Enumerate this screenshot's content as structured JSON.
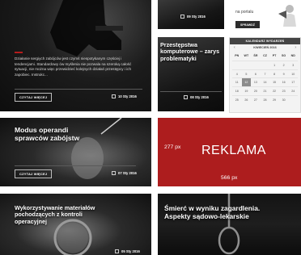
{
  "read_more_label": "CZYTAJ WIĘCEJ",
  "card_top_left": {
    "excerpt": "Działanie sergiych zabójców jest czymś niespotykanym częściej i tendencjami. Standardowy ów myślenia nie pozwala na szeroką całość sytuacji, nie można więc przewidzieć kolejnych działań przestępcy i ich zapobiec. Instrukc...",
    "date": "10 Sty 2016"
  },
  "card_top_middle": {
    "date": "09 Sty 2016"
  },
  "card_przestepstwa": {
    "title": "Przestępstwa komputerowe – zarys problematyki",
    "date": "08 Sty 2016"
  },
  "card_modus": {
    "title": "Modus operandi sprawców zabójstw",
    "date": "07 Sty 2016"
  },
  "card_wykorzystywanie": {
    "title": "Wykorzystywanie materiałów pochodzących z kontroli operacyjnej",
    "date": "05 Sty 2016"
  },
  "card_smierc": {
    "title": "Śmierć w wyniku zagardlenia. Aspekty sądowo-lekarskie"
  },
  "promo": {
    "text": "na portalu",
    "button_label": "SPRAWDŹ"
  },
  "ad": {
    "label": "REKLAMA",
    "size_left": "277 px",
    "size_bottom": "566 px"
  },
  "calendar": {
    "heading": "KALENDARZ WYDARZEŃ",
    "month": "KWIECIEŃ 2016",
    "prev": "‹",
    "next": "›",
    "weekdays": [
      "PN",
      "WT",
      "ŚR",
      "CZ",
      "PT",
      "SO",
      "ND"
    ],
    "days": [
      "",
      "",
      "",
      "",
      "1",
      "2",
      "3",
      "4",
      "5",
      "6",
      "7",
      "8",
      "9",
      "10",
      "11",
      "12",
      "13",
      "14",
      "15",
      "16",
      "17",
      "18",
      "19",
      "20",
      "21",
      "22",
      "23",
      "24",
      "25",
      "26",
      "27",
      "28",
      "29",
      "30",
      ""
    ],
    "today": "12"
  },
  "colors": {
    "accent": "#b51c1c",
    "ad_background": "#ad1d1e",
    "calendar_header": "#444444"
  }
}
